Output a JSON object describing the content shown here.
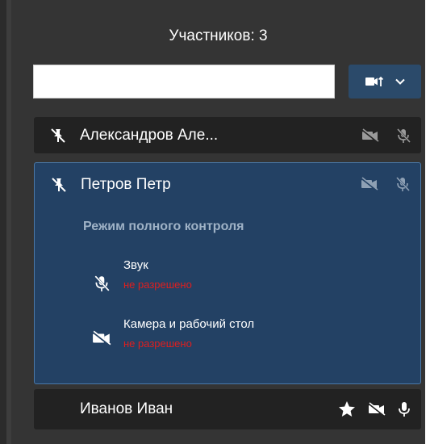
{
  "header": {
    "title": "Участников: 3"
  },
  "search": {
    "value": "",
    "placeholder": ""
  },
  "colors": {
    "panel_bg": "#343434",
    "row_bg": "#222222",
    "selected_row_bg": "#234164",
    "selected_border": "#4b79a8",
    "accent_button": "#2b4a6a",
    "status_red": "#e01e1e",
    "mode_text": "#9fb2c6"
  },
  "participants": [
    {
      "name": "Александров Але...",
      "icons": [
        "unpin-icon",
        "camera-off-icon",
        "mic-off-icon"
      ]
    },
    {
      "name": "Петров Петр",
      "icons": [
        "unpin-icon",
        "camera-off-icon",
        "mic-off-icon"
      ],
      "details": {
        "mode": "Режим полного контроля",
        "permissions": [
          {
            "title": "Звук",
            "status": "не разрешено",
            "icon": "mic-off-icon"
          },
          {
            "title": "Камера и рабочий стол",
            "status": "не разрешено",
            "icon": "camera-off-icon"
          }
        ]
      }
    },
    {
      "name": "Иванов Иван",
      "icons": [
        "star-icon",
        "camera-off-icon",
        "mic-icon"
      ]
    }
  ]
}
